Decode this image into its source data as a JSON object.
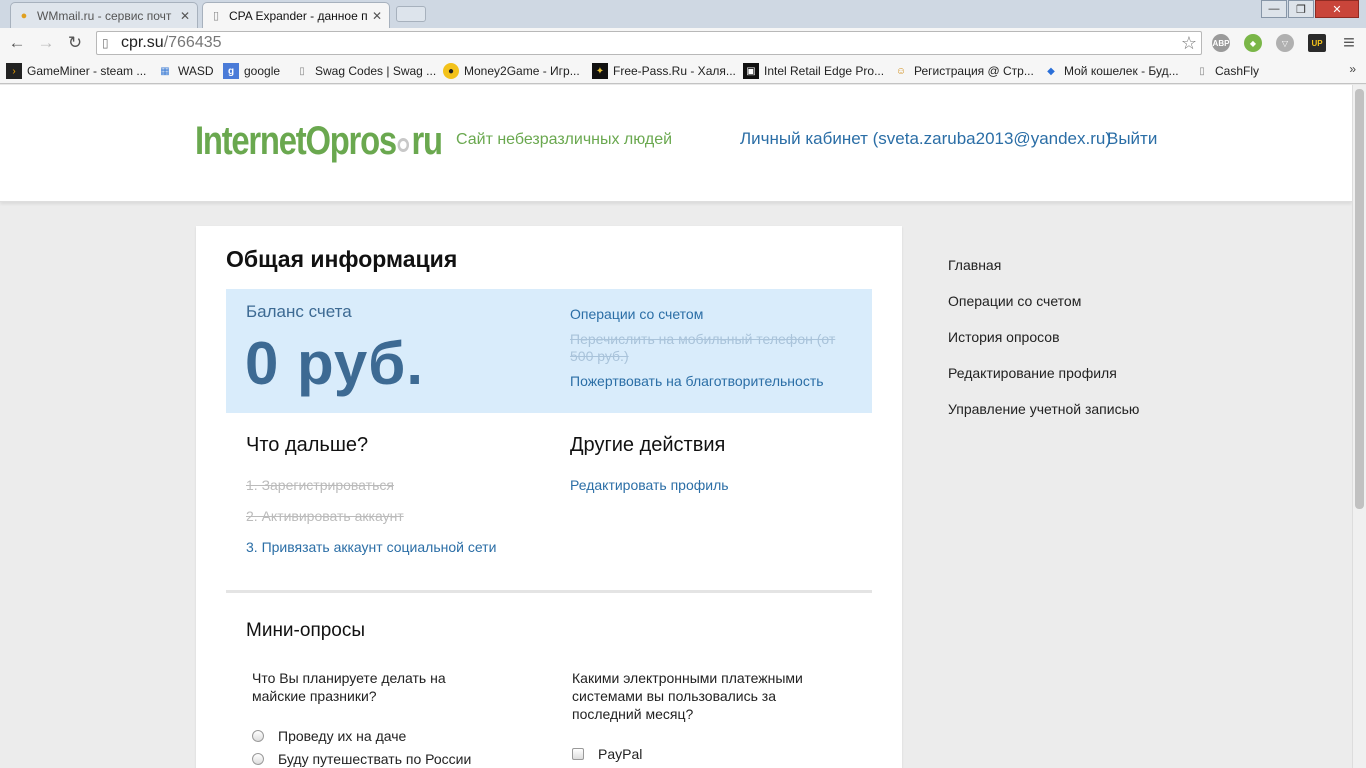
{
  "browser": {
    "tabs": [
      {
        "title": "WMmail.ru - сервис почт",
        "close": "✕"
      },
      {
        "title": "CPA Expander - данное пр",
        "close": "✕"
      }
    ],
    "window_buttons": {
      "minimize": "—",
      "maximize": "❐",
      "close": "✕"
    },
    "nav": {
      "back": "←",
      "forward": "→",
      "reload": "↻"
    },
    "url_host": "cpr.su",
    "url_path": "/766435",
    "star": "☆",
    "extensions": [
      {
        "label": "ABP",
        "color": "#9a9a9a"
      },
      {
        "label": "◆",
        "color": "#7ab648"
      },
      {
        "label": "▽",
        "color": "#b0b0b0"
      },
      {
        "label": "UP",
        "color": "#2a2a2a"
      }
    ],
    "menu_icon": "≡",
    "bookmarks": [
      "GameMiner - steam ...",
      "WASD",
      "google",
      "Swag Codes | Swag ...",
      "Money2Game - Игр...",
      "Free-Pass.Ru - Халя...",
      "Intel Retail Edge Pro...",
      "Регистрация @ Стр...",
      "Мой кошелек - Буд...",
      "CashFly"
    ],
    "bookmarks_more": "»"
  },
  "header": {
    "logo_left": "Internet",
    "logo_mid": "Opros",
    "logo_right": "ru",
    "tagline": "Сайт небезразличных людей",
    "account_link": "Личный кабинет (sveta.zaruba2013@yandex.ru)",
    "logout": "Выйти"
  },
  "main": {
    "title": "Общая информация",
    "balance": {
      "label": "Баланс счета",
      "value": "0 руб.",
      "links": [
        "Операции со счетом",
        "Перечислить на мобильный телефон (от 500 руб.)",
        "Пожертвовать на благотворительность"
      ]
    },
    "next": {
      "heading": "Что дальше?",
      "steps": [
        "1. Зарегистрироваться",
        "2. Активировать аккаунт",
        "3. Привязать аккаунт социальной сети"
      ]
    },
    "other": {
      "heading": "Другие действия",
      "edit_profile": "Редактировать профиль"
    },
    "mini_polls": {
      "heading": "Мини-опросы",
      "poll1": {
        "question": "Что Вы планируете делать на майские празники?",
        "options": [
          "Проведу их на даче",
          "Буду путешествать по России"
        ]
      },
      "poll2": {
        "question": "Какими электронными платежными системами вы пользовались за последний месяц?",
        "options": [
          "PayPal"
        ]
      }
    }
  },
  "sidebar": {
    "items": [
      "Главная",
      "Операции со счетом",
      "История опросов",
      "Редактирование профиля",
      "Управление учетной записью"
    ]
  }
}
